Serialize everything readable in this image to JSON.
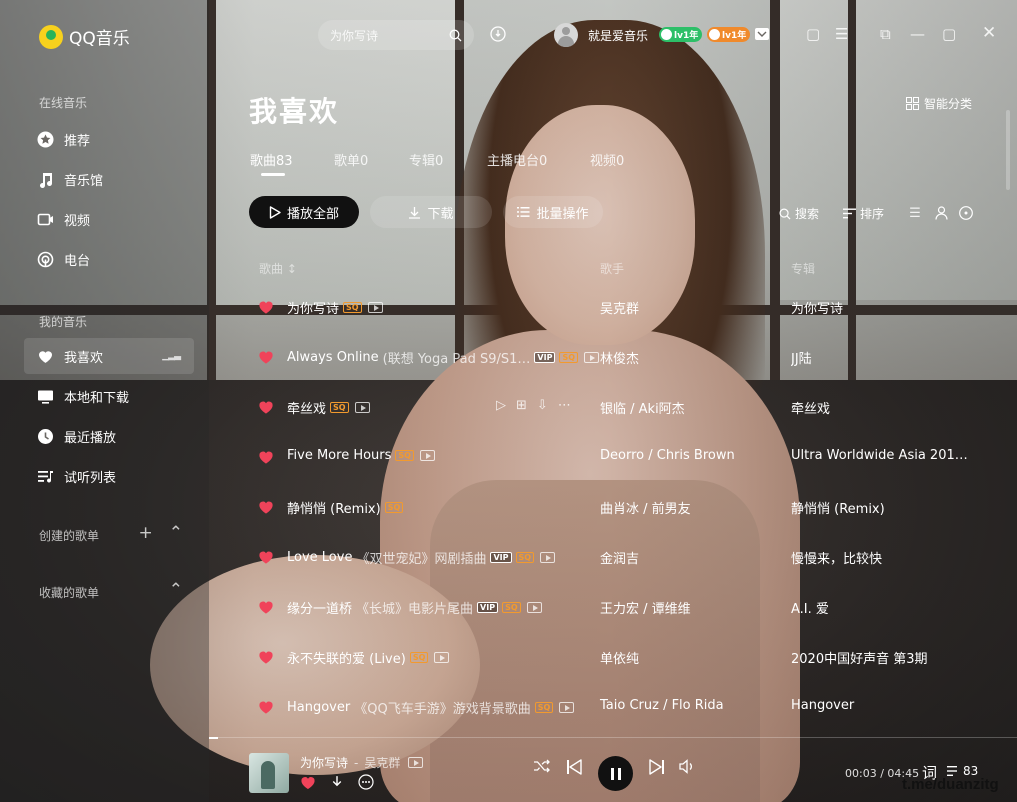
{
  "app": {
    "name": "QQ音乐"
  },
  "search": {
    "placeholder": "为你写诗"
  },
  "user": {
    "name": "就是爱音乐",
    "badges": [
      {
        "label": "lv1年",
        "color": "#2dbf68"
      },
      {
        "label": "lv1年",
        "color": "#f08a2c"
      }
    ]
  },
  "sidebar": {
    "online_title": "在线音乐",
    "online_items": [
      {
        "label": "推荐",
        "icon": "star-circle-icon"
      },
      {
        "label": "音乐馆",
        "icon": "music-note-icon"
      },
      {
        "label": "视频",
        "icon": "video-icon"
      },
      {
        "label": "电台",
        "icon": "radio-icon"
      }
    ],
    "my_title": "我的音乐",
    "my_items": [
      {
        "label": "我喜欢",
        "icon": "heart-icon",
        "active": true
      },
      {
        "label": "本地和下载",
        "icon": "monitor-icon"
      },
      {
        "label": "最近播放",
        "icon": "clock-icon"
      },
      {
        "label": "试听列表",
        "icon": "playlist-icon"
      }
    ],
    "created_title": "创建的歌单",
    "favorited_title": "收藏的歌单"
  },
  "page": {
    "title": "我喜欢",
    "smart_label": "智能分类",
    "tabs": [
      {
        "label": "歌曲83",
        "active": true
      },
      {
        "label": "歌单0"
      },
      {
        "label": "专辑0"
      },
      {
        "label": "主播电台0"
      },
      {
        "label": "视频0"
      }
    ],
    "play_all": "播放全部",
    "download": "下载",
    "batch": "批量操作",
    "search": "搜索",
    "sort": "排序",
    "columns": {
      "title": "歌曲",
      "artist": "歌手",
      "album": "专辑"
    }
  },
  "songs": [
    {
      "title": "为你写诗",
      "sub": "",
      "tags": [
        "SQ"
      ],
      "mv": true,
      "artist": "吴克群",
      "album": "为你写诗"
    },
    {
      "title": "Always Online",
      "sub": "(联想 Yoga Pad S9/S1…",
      "tags": [
        "VIP",
        "SQ"
      ],
      "mv": true,
      "artist": "林俊杰",
      "album": "JJ陆"
    },
    {
      "title": "牵丝戏",
      "sub": "",
      "tags": [
        "SQ"
      ],
      "mv": true,
      "artist": "银临 / Aki阿杰",
      "album": "牵丝戏",
      "hover": true
    },
    {
      "title": "Five More Hours",
      "sub": "",
      "tags": [
        "SQ"
      ],
      "mv": true,
      "artist": "Deorro / Chris Brown",
      "album": "Ultra Worldwide Asia 201…"
    },
    {
      "title": "静悄悄 (Remix)",
      "sub": "",
      "tags": [
        "SQ"
      ],
      "mv": false,
      "artist": "曲肖冰 / 前男友",
      "album": "静悄悄 (Remix)"
    },
    {
      "title": "Love Love",
      "sub": "《双世宠妃》网剧插曲",
      "tags": [
        "VIP",
        "SQ"
      ],
      "mv": true,
      "artist": "金润吉",
      "album": "慢慢来，比较快"
    },
    {
      "title": "缘分一道桥",
      "sub": "《长城》电影片尾曲",
      "tags": [
        "VIP",
        "SQ"
      ],
      "mv": true,
      "artist": "王力宏 / 谭维维",
      "album": "A.I. 爱"
    },
    {
      "title": "永不失联的爱 (Live)",
      "sub": "",
      "tags": [
        "SQ"
      ],
      "mv": true,
      "artist": "单依纯",
      "album": "2020中国好声音 第3期"
    },
    {
      "title": "Hangover",
      "sub": "《QQ飞车手游》游戏背景歌曲",
      "tags": [
        "SQ"
      ],
      "mv": true,
      "artist": "Taio Cruz / Flo Rida",
      "album": "Hangover"
    }
  ],
  "player": {
    "title": "为你写诗",
    "separator": "-",
    "artist": "吴克群",
    "time": "00:03 / 04:45",
    "progress": 0.011,
    "lyric": "词",
    "count": "83"
  },
  "watermark": "t.me/duanzitg"
}
